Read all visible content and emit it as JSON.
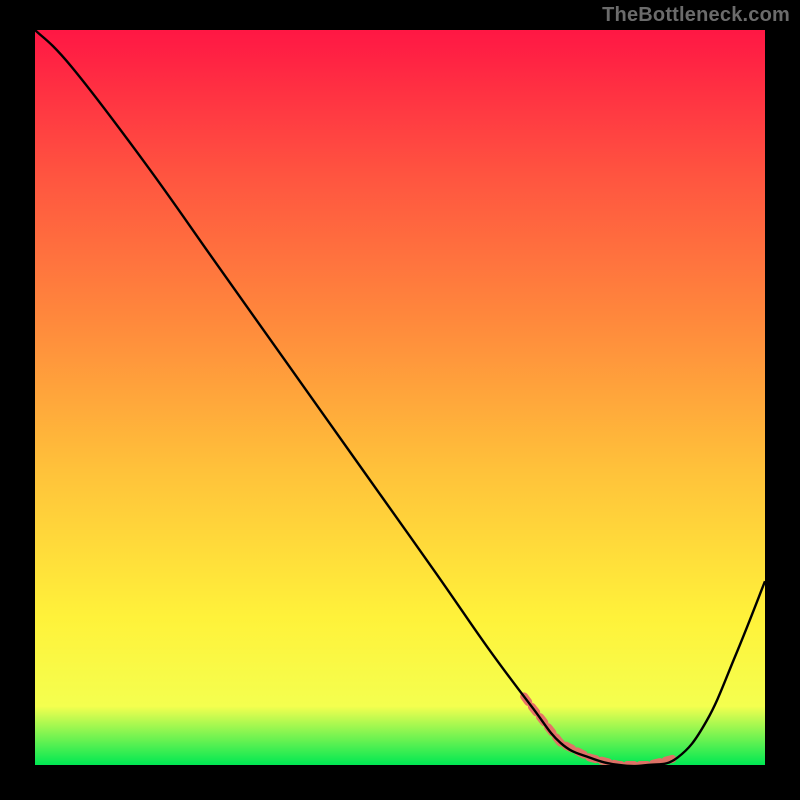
{
  "watermark": "TheBottleneck.com",
  "colors": {
    "gradient_top": "#ff1744",
    "gradient_mid1": "#ff5540",
    "gradient_mid2": "#ff8a3c",
    "gradient_mid3": "#ffc23a",
    "gradient_mid4": "#fff23a",
    "gradient_mid5": "#f4ff4f",
    "gradient_bottom": "#00e853",
    "curve": "#000000",
    "highlight": "#e96a67"
  },
  "chart_data": {
    "type": "line",
    "title": "",
    "xlabel": "",
    "ylabel": "",
    "xlim": [
      0,
      100
    ],
    "ylim": [
      0,
      100
    ],
    "series": [
      {
        "name": "curve",
        "x": [
          0,
          5,
          15,
          25,
          35,
          45,
          55,
          62,
          68,
          72,
          76,
          80,
          84,
          88,
          92,
          96,
          100
        ],
        "values": [
          100,
          95,
          82,
          68,
          54,
          40,
          26,
          16,
          8,
          3,
          1,
          0,
          0,
          1,
          6,
          15,
          25
        ]
      }
    ],
    "highlight_range_x": [
      67,
      88
    ],
    "gradient_stops": [
      {
        "offset": 0.0,
        "color": "#ff1744"
      },
      {
        "offset": 0.2,
        "color": "#ff5540"
      },
      {
        "offset": 0.4,
        "color": "#ff8a3c"
      },
      {
        "offset": 0.6,
        "color": "#ffc23a"
      },
      {
        "offset": 0.8,
        "color": "#fff23a"
      },
      {
        "offset": 0.92,
        "color": "#f4ff4f"
      },
      {
        "offset": 1.0,
        "color": "#00e853"
      }
    ]
  }
}
